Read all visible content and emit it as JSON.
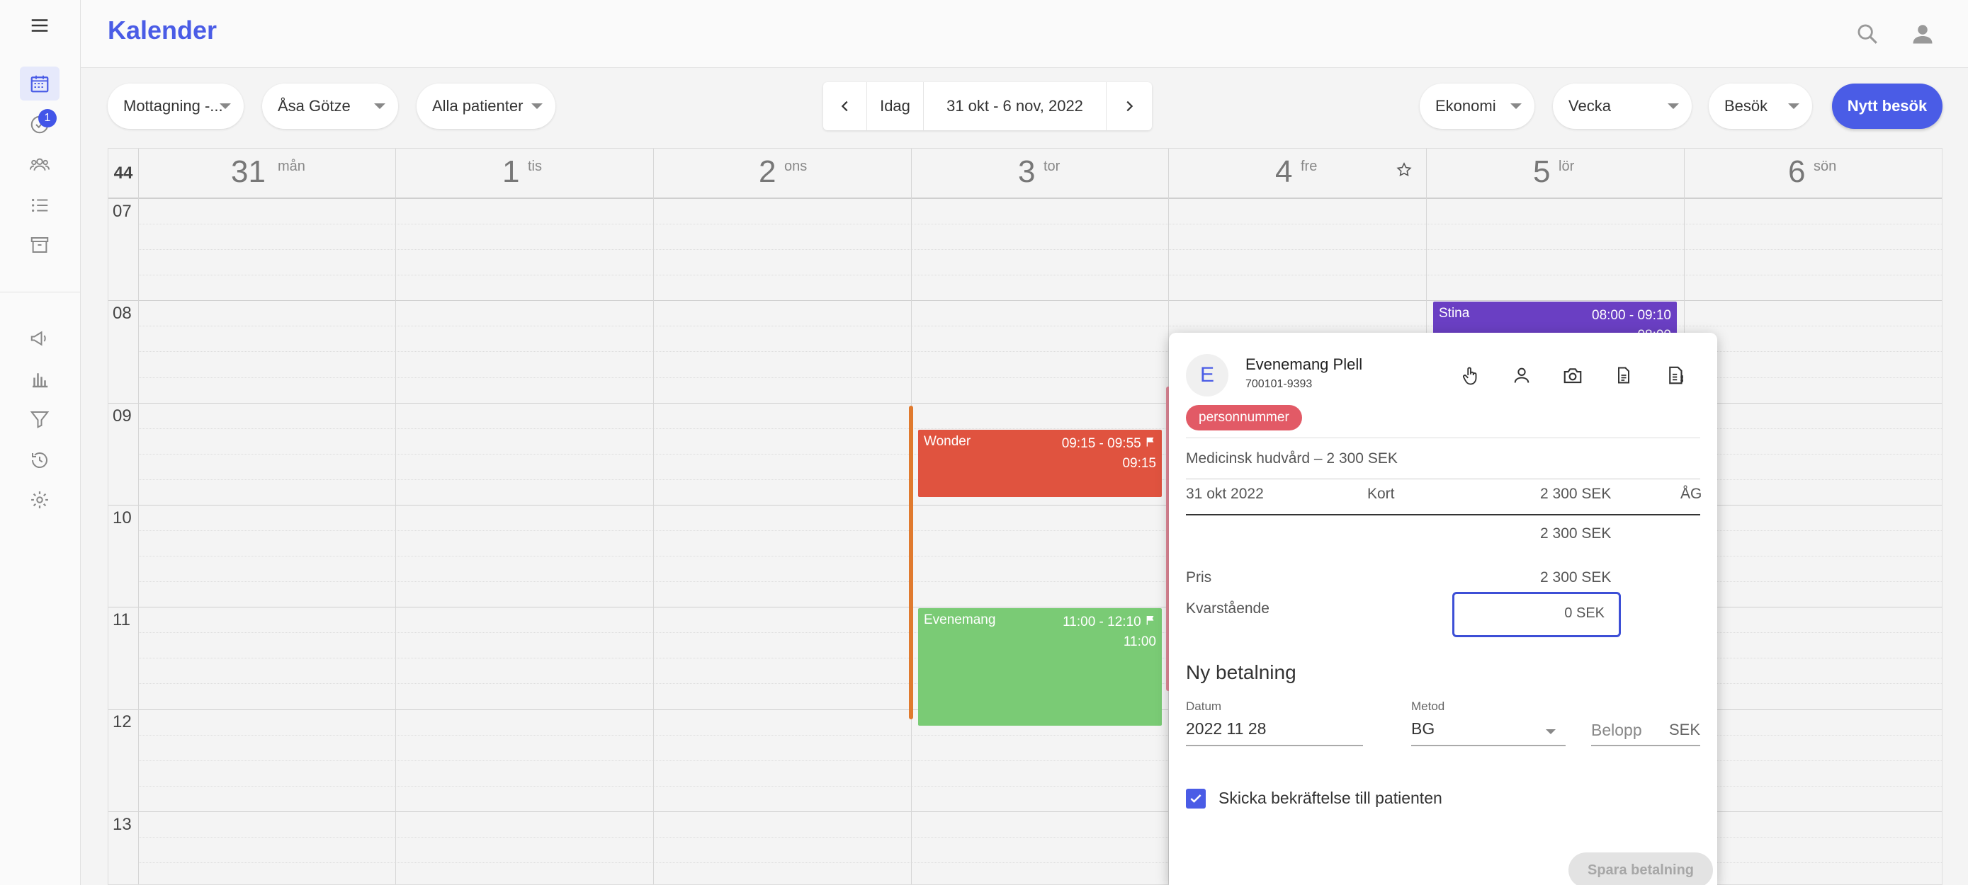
{
  "header": {
    "title": "Kalender"
  },
  "sidebar": {
    "tasks_badge": "1"
  },
  "toolbar": {
    "clinic": "Mottagning -...",
    "practitioner": "Åsa Götze",
    "patients": "Alla patienter",
    "today": "Idag",
    "range": "31 okt - 6 nov, 2022",
    "economy": "Ekonomi",
    "view": "Vecka",
    "type": "Besök",
    "new_visit": "Nytt besök"
  },
  "calendar": {
    "week": "44",
    "days": [
      {
        "num": "31",
        "name": "mån"
      },
      {
        "num": "1",
        "name": "tis"
      },
      {
        "num": "2",
        "name": "ons"
      },
      {
        "num": "3",
        "name": "tor"
      },
      {
        "num": "4",
        "name": "fre"
      },
      {
        "num": "5",
        "name": "lör"
      },
      {
        "num": "6",
        "name": "sön"
      }
    ],
    "hours": [
      "07",
      "08",
      "09",
      "10",
      "11",
      "12",
      "13"
    ],
    "events": [
      {
        "title": "Stina",
        "time": "08:00 - 09:10",
        "start": "08:00",
        "color": "#6a3fc3"
      },
      {
        "title": "Wonder",
        "time": "09:15 - 09:55",
        "start": "09:15",
        "color": "#e0533f"
      },
      {
        "title": "Evenemang",
        "time": "11:00 - 12:10",
        "start": "11:00",
        "color": "#7acb75"
      }
    ]
  },
  "popup": {
    "avatar_letter": "E",
    "patient_name": "Evenemang Plell",
    "patient_id": "700101-9393",
    "tag": "personnummer",
    "service": "Medicinsk hudvård – 2 300 SEK",
    "payment_row": {
      "date": "31 okt 2022",
      "method": "Kort",
      "amount": "2 300 SEK",
      "by": "ÅG"
    },
    "paid_total": "2 300 SEK",
    "price_label": "Pris",
    "price_value": "2 300 SEK",
    "remaining_label": "Kvarstående",
    "remaining_value": "0 SEK",
    "new_payment_title": "Ny betalning",
    "date_label": "Datum",
    "date_value": "2022 11 28",
    "method_label": "Metod",
    "method_value": "BG",
    "amount_placeholder": "Belopp",
    "amount_unit": "SEK",
    "confirm_label": "Skicka bekräftelse till patienten",
    "save_label": "Spara betalning"
  }
}
